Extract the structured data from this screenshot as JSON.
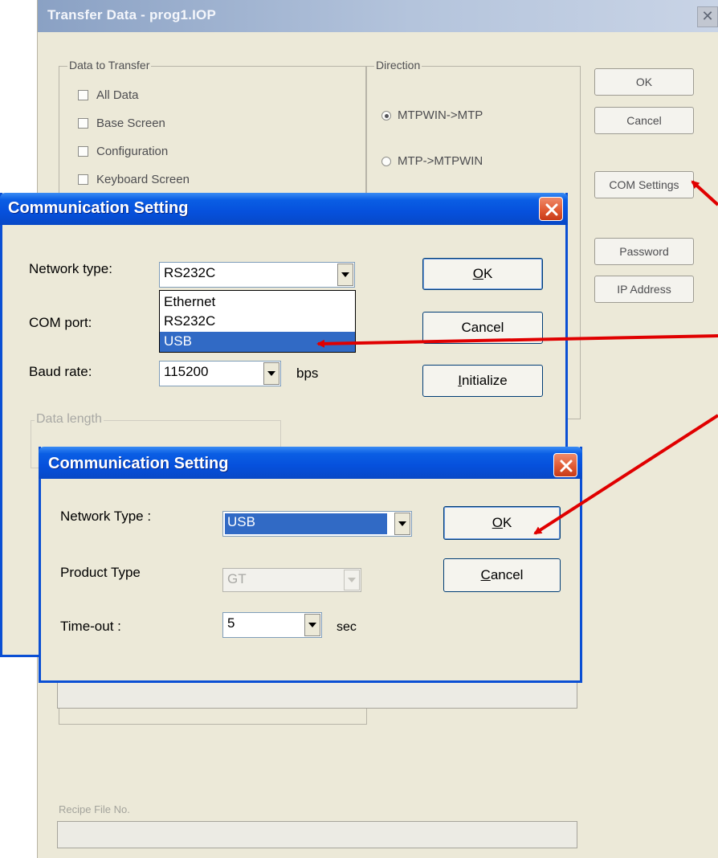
{
  "transfer_window": {
    "title": "Transfer Data - prog1.IOP",
    "data_group_label": "Data to Transfer",
    "checkboxes": [
      {
        "label": "All Data",
        "checked": false
      },
      {
        "label": "Base Screen",
        "checked": false
      },
      {
        "label": "Configuration",
        "checked": false
      },
      {
        "label": "Keyboard Screen",
        "checked": false
      }
    ],
    "direction_label": "Direction",
    "directions": [
      {
        "label": "MTPWIN->MTP",
        "selected": true
      },
      {
        "label": "MTP->MTPWIN",
        "selected": false
      }
    ],
    "buttons": {
      "ok": "OK",
      "cancel": "Cancel",
      "com_settings": "COM Settings",
      "password": "Password",
      "ip_address": "IP Address"
    },
    "recipe_label": "Recipe File No."
  },
  "comm_dialog_1": {
    "title": "Communication Setting",
    "network_type_label": "Network type:",
    "network_type_value": "RS232C",
    "dropdown_options": [
      "Ethernet",
      "RS232C",
      "USB"
    ],
    "dropdown_selected": "USB",
    "com_port_label": "COM port:",
    "baud_rate_label": "Baud rate:",
    "baud_rate_value": "115200",
    "baud_unit": "bps",
    "data_length_label": "Data length",
    "buttons": {
      "ok_prefix": "",
      "ok_mnemonic": "O",
      "ok_rest": "K",
      "cancel": "Cancel",
      "init_mnemonic": "I",
      "init_rest": "nitialize"
    }
  },
  "comm_dialog_2": {
    "title": "Communication Setting",
    "network_type_label": "Network Type :",
    "network_type_value": "USB",
    "product_type_label": "Product Type",
    "product_type_value": "GT",
    "timeout_label": "Time-out :",
    "timeout_value": "5",
    "timeout_unit": "sec",
    "buttons": {
      "ok_mnemonic": "O",
      "ok_rest": "K",
      "cancel_mnemonic": "C",
      "cancel_rest": "ancel"
    }
  },
  "colors": {
    "xp_title_blue": "#0650dc",
    "selection_blue": "#316ac5",
    "arrow_red": "#e00000"
  },
  "icons": [
    "close-icon",
    "chevron-down-icon",
    "checkbox",
    "radio"
  ]
}
